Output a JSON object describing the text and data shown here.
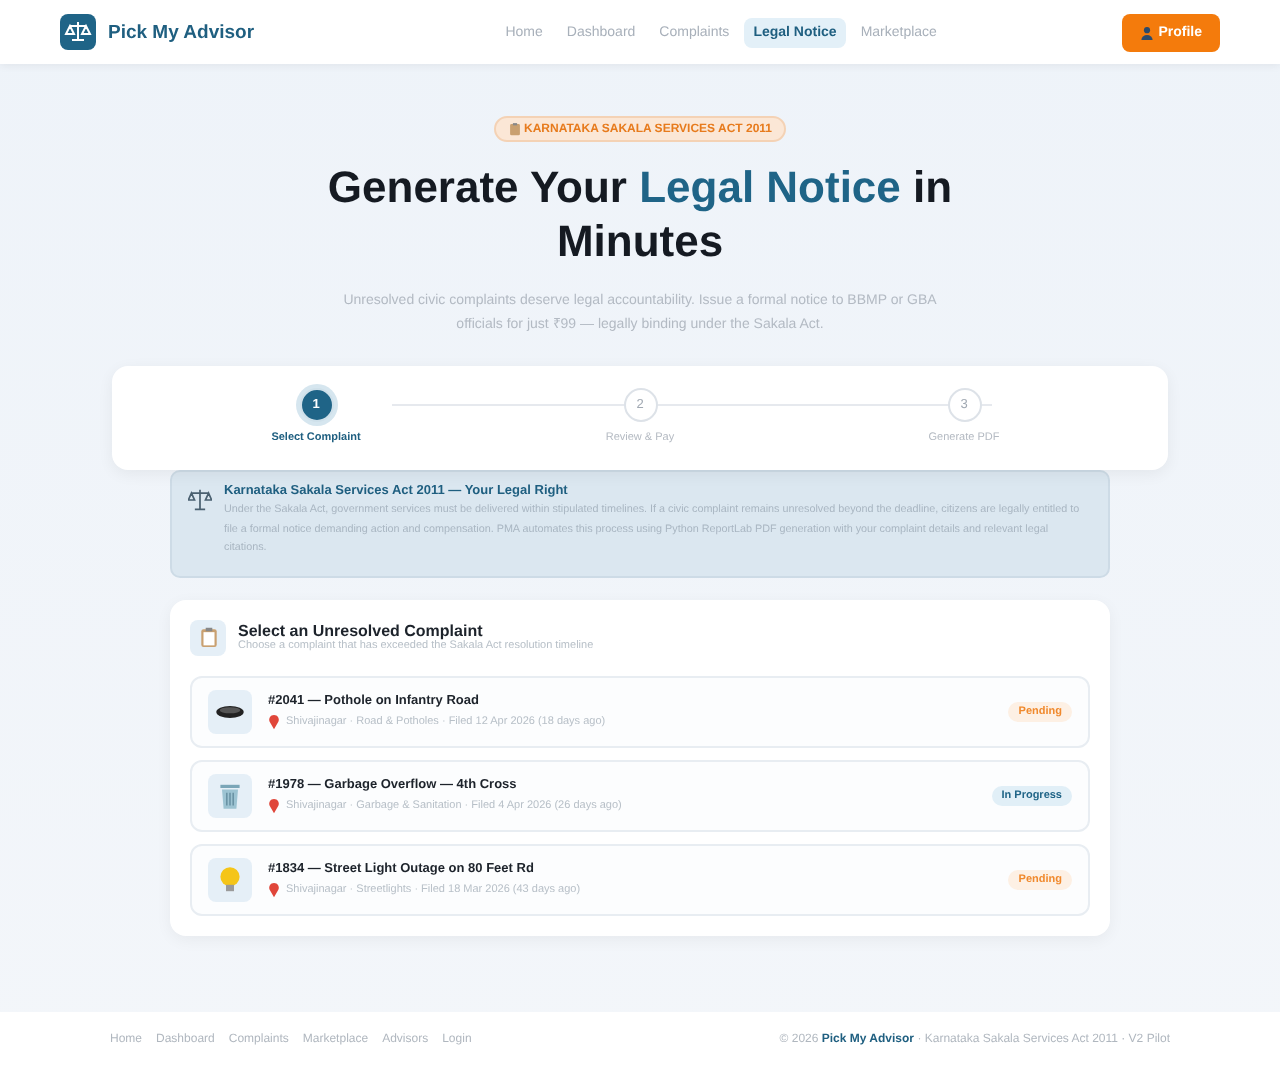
{
  "brand": "Pick My Advisor",
  "nav": [
    {
      "label": "Home",
      "selected": false
    },
    {
      "label": "Dashboard",
      "selected": false
    },
    {
      "label": "Complaints",
      "selected": false
    },
    {
      "label": "Legal Notice",
      "selected": true
    },
    {
      "label": "Marketplace",
      "selected": false
    }
  ],
  "profile_button": "Profile",
  "hero": {
    "badge": "KARNATAKA SAKALA SERVICES ACT 2011",
    "title_start": "Generate Your ",
    "title_highlight": "Legal Notice",
    "title_end": " in Minutes",
    "subtitle": "Unresolved civic complaints deserve legal accountability. Issue a formal notice to BBMP or GBA officials for just ₹99 — legally binding under the Sakala Act."
  },
  "steps": [
    {
      "number": "1",
      "label": "Select Complaint",
      "selected": true
    },
    {
      "number": "2",
      "label": "Review & Pay",
      "selected": false
    },
    {
      "number": "3",
      "label": "Generate PDF",
      "selected": false
    }
  ],
  "info": {
    "title": "Karnataka Sakala Services Act 2011 — Your Legal Right",
    "text": "Under the Sakala Act, government services must be delivered within stipulated timelines. If a civic complaint remains unresolved beyond the deadline, citizens are legally entitled to file a formal notice demanding action and compensation. PMA automates this process using Python ReportLab PDF generation with your complaint details and relevant legal citations."
  },
  "complaints_panel": {
    "title": "Select an Unresolved Complaint",
    "subtitle": "Choose a complaint that has exceeded the Sakala Act resolution timeline",
    "items": [
      {
        "kind": "pothole",
        "title": "#2041 — Pothole on Infantry Road",
        "meta": "Shivajinagar · Road & Potholes · Filed 12 Apr 2026 (18 days ago)",
        "status": {
          "label": "Pending",
          "kind": "pending"
        }
      },
      {
        "kind": "garbage",
        "title": "#1978 — Garbage Overflow — 4th Cross",
        "meta": "Shivajinagar · Garbage & Sanitation · Filed 4 Apr 2026 (26 days ago)",
        "status": {
          "label": "In Progress",
          "kind": "progress"
        }
      },
      {
        "kind": "light",
        "title": "#1834 — Street Light Outage on 80 Feet Rd",
        "meta": "Shivajinagar · Streetlights · Filed 18 Mar 2026 (43 days ago)",
        "status": {
          "label": "Pending",
          "kind": "pending"
        }
      }
    ]
  },
  "footer": {
    "links": [
      "Home",
      "Dashboard",
      "Complaints",
      "Marketplace",
      "Advisors",
      "Login"
    ],
    "copyright": "© 2026 **Pick My Advisor** · Karnataka Sakala Services Act 2011 · V2 Pilot"
  }
}
